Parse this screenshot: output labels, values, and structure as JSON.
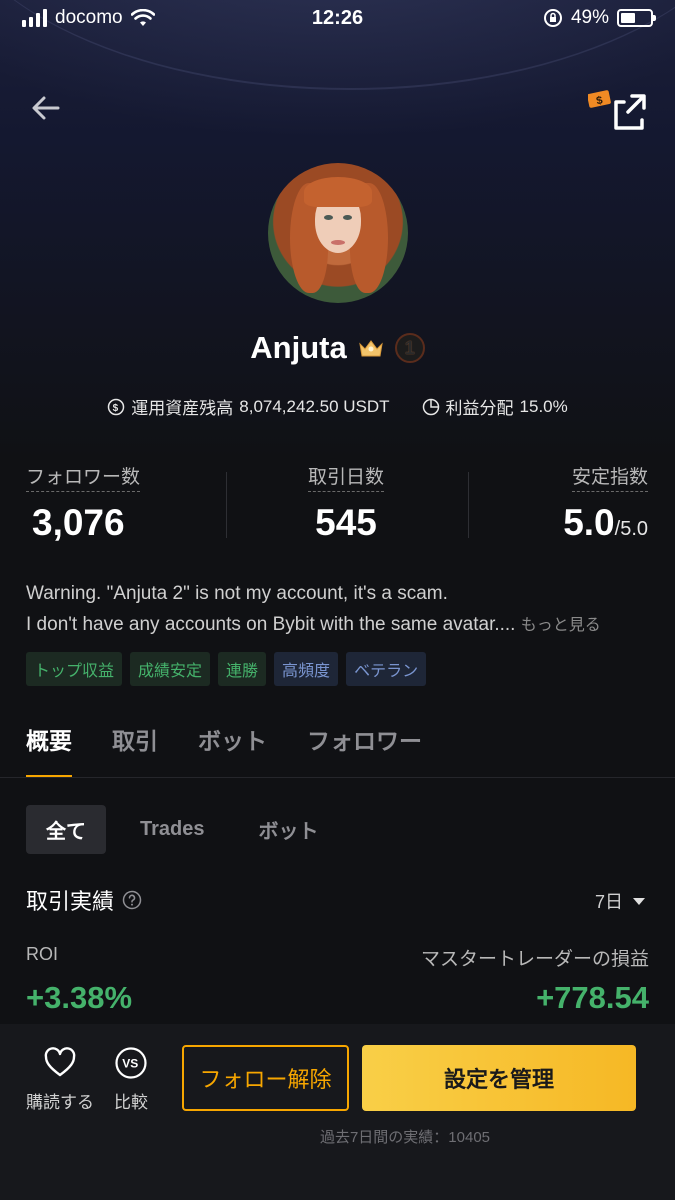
{
  "status_bar": {
    "carrier": "docomo",
    "time": "12:26",
    "battery": "49%"
  },
  "profile": {
    "name": "Anjuta",
    "rank_badge": "1",
    "aum_label": "運用資産残高",
    "aum_value": "8,074,242.50 USDT",
    "profit_share_label": "利益分配",
    "profit_share_value": "15.0%"
  },
  "stats": {
    "followers_label": "フォロワー数",
    "followers_value": "3,076",
    "trading_days_label": "取引日数",
    "trading_days_value": "545",
    "stability_label": "安定指数",
    "stability_value": "5.0",
    "stability_max": "/5.0"
  },
  "bio": {
    "line1": "Warning. \"Anjuta 2\" is not my account, it's a scam.",
    "line2": "I don't have any accounts on Bybit with the same avatar....",
    "more": "もっと見る"
  },
  "tags": [
    "トップ収益",
    "成績安定",
    "連勝",
    "高頻度",
    "ベテラン"
  ],
  "tabs": [
    "概要",
    "取引",
    "ボット",
    "フォロワー"
  ],
  "subtabs": [
    "全て",
    "Trades",
    "ボット"
  ],
  "performance": {
    "title": "取引実績",
    "period": "7日",
    "roi_label": "ROI",
    "roi_value": "+3.38%",
    "pnl_label": "マスタートレーダーの損益",
    "pnl_value": "+778.54"
  },
  "bottom": {
    "subscribe_label": "購読する",
    "compare_label": "比較",
    "compare_icon_text": "VS",
    "unfollow_label": "フォロー解除",
    "manage_label": "設定を管理",
    "footnote": "過去7日間の実績：10405"
  },
  "colors": {
    "accent": "#f7a600",
    "positive": "#45b26b",
    "background": "#101114"
  },
  "icons": {
    "back": "arrow-left-icon",
    "share": "share-external-icon",
    "crown": "crown-icon",
    "aum": "dollar-circle-icon",
    "profit": "pie-chart-icon",
    "help": "help-circle-icon",
    "heart": "heart-icon"
  }
}
